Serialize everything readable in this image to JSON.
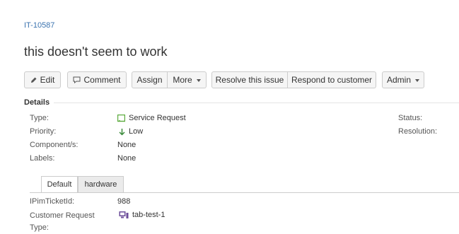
{
  "issue": {
    "key": "IT-10587",
    "title": "this doesn't seem to work"
  },
  "toolbar": {
    "edit": "Edit",
    "comment": "Comment",
    "assign": "Assign",
    "more": "More",
    "resolve": "Resolve this issue",
    "respond": "Respond to customer",
    "admin": "Admin"
  },
  "details": {
    "heading": "Details",
    "type_label": "Type:",
    "type_value": "Service Request",
    "priority_label": "Priority:",
    "priority_value": "Low",
    "components_label": "Component/s:",
    "components_value": "None",
    "labels_label": "Labels:",
    "labels_value": "None",
    "status_label": "Status:",
    "resolution_label": "Resolution:"
  },
  "tabs": {
    "default": "Default",
    "hardware": "hardware"
  },
  "custom": {
    "ipim_label": "IPimTicketId:",
    "ipim_value": "988",
    "request_type_label_1": "Customer Request",
    "request_type_label_2": "Type:",
    "request_type_value": "tab-test-1"
  },
  "colors": {
    "link": "#3b73af",
    "service_request_icon": "#5aaa3b",
    "priority_low_icon": "#3a8a3a",
    "request_type_icon": "#6c4e9a"
  }
}
